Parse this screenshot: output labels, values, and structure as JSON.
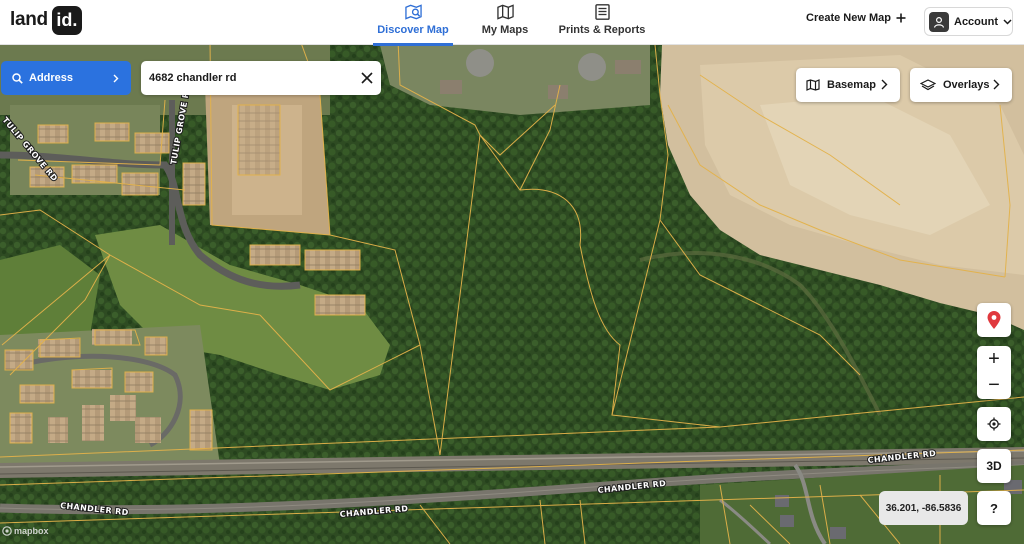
{
  "header": {
    "logo": {
      "text_land": "land",
      "text_id": "id."
    },
    "tabs": [
      {
        "label": "Discover Map",
        "icon": "map-search-icon",
        "active": true
      },
      {
        "label": "My Maps",
        "icon": "map-icon",
        "active": false
      },
      {
        "label": "Prints & Reports",
        "icon": "document-icon",
        "active": false
      }
    ],
    "create_map_label": "Create New Map",
    "account_label": "Account"
  },
  "search": {
    "type_label": "Address",
    "query": "4682 chandler rd"
  },
  "map_controls": {
    "basemap_label": "Basemap",
    "overlays_label": "Overlays",
    "zoom_in": "+",
    "zoom_out": "−",
    "three_d_label": "3D",
    "help_label": "?",
    "coordinates": "36.201, -86.5836",
    "attribution": "mapbox"
  },
  "road_labels": {
    "tulip_grove_1": "TULIP GROVE RD",
    "tulip_grove_2": "TULIP GROVE RD",
    "chandler_1": "CHANDLER RD",
    "chandler_2": "CHANDLER RD",
    "chandler_3": "CHANDLER RD",
    "chandler_4": "CHANDLER RD"
  },
  "colors": {
    "accent": "#2b72df",
    "parcel_line": "#e3b24a",
    "pin": "#e0393e"
  }
}
